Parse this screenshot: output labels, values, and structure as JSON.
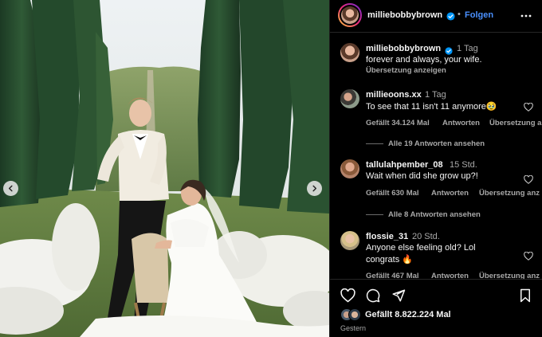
{
  "post": {
    "photo_alt_visible": "",
    "prev_button_icon": "chevron-left-icon",
    "next_button_icon": "chevron-right-icon"
  },
  "header": {
    "username": "milliebobbybrown",
    "separator": "•",
    "follow_label": "Folgen",
    "more_icon": "more-horizontal-icon"
  },
  "caption": {
    "username": "milliebobbybrown",
    "time": "1 Tag",
    "text": "forever and always, your wife.",
    "translate_label": "Übersetzung anzeigen"
  },
  "comments": [
    {
      "username": "millieoons.xx",
      "time": "1 Tag",
      "text": "To see that 11 isn't 11 anymore🥹",
      "likes": "Gefällt 34.124 Mal",
      "reply_label": "Antworten",
      "translate_label": "Übersetzung a",
      "view_replies": "Alle 19 Antworten ansehen"
    },
    {
      "username": "tallulahpember_08",
      "time": "15 Std.",
      "text": "Wait when did she grow up?!",
      "likes": "Gefällt 630 Mal",
      "reply_label": "Antworten",
      "translate_label": "Übersetzung anz",
      "view_replies": "Alle 8 Antworten ansehen"
    },
    {
      "username": "flossie_31",
      "time": "20 Std.",
      "text": "Anyone else feeling old? Lol",
      "text2": "congrats 🔥",
      "likes": "Gefällt 467 Mal",
      "reply_label": "Antworten",
      "translate_label": "Übersetzung anz"
    }
  ],
  "actions": {
    "like_icon": "heart-icon",
    "comment_icon": "comment-icon",
    "share_icon": "send-icon",
    "save_icon": "bookmark-icon",
    "likes_total": "Gefällt 8.822.224 Mal",
    "date": "Gestern"
  },
  "colors": {
    "accent": "#0095f6",
    "follow": "#4a90ff",
    "muted": "#a8a8a8",
    "background": "#000000"
  }
}
